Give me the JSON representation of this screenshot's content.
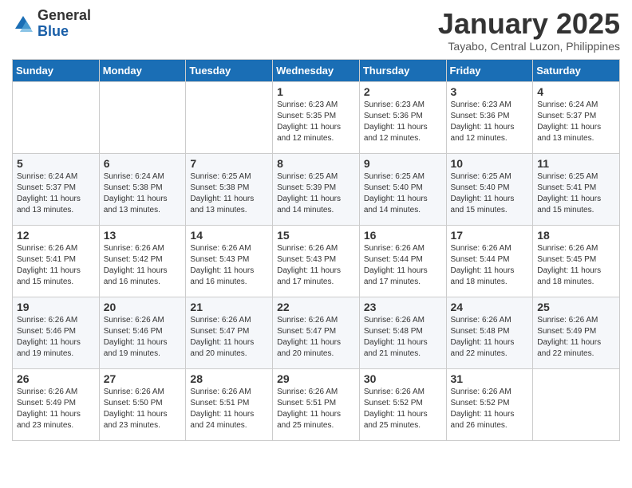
{
  "logo": {
    "general": "General",
    "blue": "Blue"
  },
  "title": "January 2025",
  "location": "Tayabo, Central Luzon, Philippines",
  "days_of_week": [
    "Sunday",
    "Monday",
    "Tuesday",
    "Wednesday",
    "Thursday",
    "Friday",
    "Saturday"
  ],
  "weeks": [
    [
      {
        "day": "",
        "info": ""
      },
      {
        "day": "",
        "info": ""
      },
      {
        "day": "",
        "info": ""
      },
      {
        "day": "1",
        "info": "Sunrise: 6:23 AM\nSunset: 5:35 PM\nDaylight: 11 hours and 12 minutes."
      },
      {
        "day": "2",
        "info": "Sunrise: 6:23 AM\nSunset: 5:36 PM\nDaylight: 11 hours and 12 minutes."
      },
      {
        "day": "3",
        "info": "Sunrise: 6:23 AM\nSunset: 5:36 PM\nDaylight: 11 hours and 12 minutes."
      },
      {
        "day": "4",
        "info": "Sunrise: 6:24 AM\nSunset: 5:37 PM\nDaylight: 11 hours and 13 minutes."
      }
    ],
    [
      {
        "day": "5",
        "info": "Sunrise: 6:24 AM\nSunset: 5:37 PM\nDaylight: 11 hours and 13 minutes."
      },
      {
        "day": "6",
        "info": "Sunrise: 6:24 AM\nSunset: 5:38 PM\nDaylight: 11 hours and 13 minutes."
      },
      {
        "day": "7",
        "info": "Sunrise: 6:25 AM\nSunset: 5:38 PM\nDaylight: 11 hours and 13 minutes."
      },
      {
        "day": "8",
        "info": "Sunrise: 6:25 AM\nSunset: 5:39 PM\nDaylight: 11 hours and 14 minutes."
      },
      {
        "day": "9",
        "info": "Sunrise: 6:25 AM\nSunset: 5:40 PM\nDaylight: 11 hours and 14 minutes."
      },
      {
        "day": "10",
        "info": "Sunrise: 6:25 AM\nSunset: 5:40 PM\nDaylight: 11 hours and 15 minutes."
      },
      {
        "day": "11",
        "info": "Sunrise: 6:25 AM\nSunset: 5:41 PM\nDaylight: 11 hours and 15 minutes."
      }
    ],
    [
      {
        "day": "12",
        "info": "Sunrise: 6:26 AM\nSunset: 5:41 PM\nDaylight: 11 hours and 15 minutes."
      },
      {
        "day": "13",
        "info": "Sunrise: 6:26 AM\nSunset: 5:42 PM\nDaylight: 11 hours and 16 minutes."
      },
      {
        "day": "14",
        "info": "Sunrise: 6:26 AM\nSunset: 5:43 PM\nDaylight: 11 hours and 16 minutes."
      },
      {
        "day": "15",
        "info": "Sunrise: 6:26 AM\nSunset: 5:43 PM\nDaylight: 11 hours and 17 minutes."
      },
      {
        "day": "16",
        "info": "Sunrise: 6:26 AM\nSunset: 5:44 PM\nDaylight: 11 hours and 17 minutes."
      },
      {
        "day": "17",
        "info": "Sunrise: 6:26 AM\nSunset: 5:44 PM\nDaylight: 11 hours and 18 minutes."
      },
      {
        "day": "18",
        "info": "Sunrise: 6:26 AM\nSunset: 5:45 PM\nDaylight: 11 hours and 18 minutes."
      }
    ],
    [
      {
        "day": "19",
        "info": "Sunrise: 6:26 AM\nSunset: 5:46 PM\nDaylight: 11 hours and 19 minutes."
      },
      {
        "day": "20",
        "info": "Sunrise: 6:26 AM\nSunset: 5:46 PM\nDaylight: 11 hours and 19 minutes."
      },
      {
        "day": "21",
        "info": "Sunrise: 6:26 AM\nSunset: 5:47 PM\nDaylight: 11 hours and 20 minutes."
      },
      {
        "day": "22",
        "info": "Sunrise: 6:26 AM\nSunset: 5:47 PM\nDaylight: 11 hours and 20 minutes."
      },
      {
        "day": "23",
        "info": "Sunrise: 6:26 AM\nSunset: 5:48 PM\nDaylight: 11 hours and 21 minutes."
      },
      {
        "day": "24",
        "info": "Sunrise: 6:26 AM\nSunset: 5:48 PM\nDaylight: 11 hours and 22 minutes."
      },
      {
        "day": "25",
        "info": "Sunrise: 6:26 AM\nSunset: 5:49 PM\nDaylight: 11 hours and 22 minutes."
      }
    ],
    [
      {
        "day": "26",
        "info": "Sunrise: 6:26 AM\nSunset: 5:49 PM\nDaylight: 11 hours and 23 minutes."
      },
      {
        "day": "27",
        "info": "Sunrise: 6:26 AM\nSunset: 5:50 PM\nDaylight: 11 hours and 23 minutes."
      },
      {
        "day": "28",
        "info": "Sunrise: 6:26 AM\nSunset: 5:51 PM\nDaylight: 11 hours and 24 minutes."
      },
      {
        "day": "29",
        "info": "Sunrise: 6:26 AM\nSunset: 5:51 PM\nDaylight: 11 hours and 25 minutes."
      },
      {
        "day": "30",
        "info": "Sunrise: 6:26 AM\nSunset: 5:52 PM\nDaylight: 11 hours and 25 minutes."
      },
      {
        "day": "31",
        "info": "Sunrise: 6:26 AM\nSunset: 5:52 PM\nDaylight: 11 hours and 26 minutes."
      },
      {
        "day": "",
        "info": ""
      }
    ]
  ]
}
